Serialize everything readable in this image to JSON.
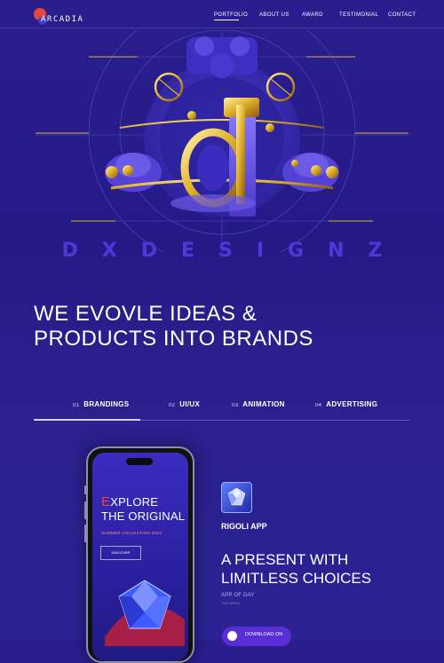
{
  "header": {
    "logo_text": "ARCADIA",
    "nav": [
      {
        "label": "PORTFOLIO"
      },
      {
        "label": "ABOUT US"
      },
      {
        "label": "AWARD"
      },
      {
        "label": "TESTIMONIAL"
      },
      {
        "label": "CONTACT"
      }
    ],
    "active_nav": "PORTFOLIO"
  },
  "hero": {
    "brand_word": "DXDESIGNZ",
    "headline_line1": "WE EVOVLE IDEAS &",
    "headline_line2": "PRODUCTS INTO BRANDS"
  },
  "tabs": [
    {
      "num": "01",
      "label": "BRANDINGS"
    },
    {
      "num": "02",
      "label": "UI/UX"
    },
    {
      "num": "03",
      "label": "ANIMATION"
    },
    {
      "num": "04",
      "label": "ADVERTISING"
    }
  ],
  "active_tab": "BRANDINGS",
  "phone": {
    "title_first_letter": "E",
    "title_rest_line1": "XPLORE",
    "title_line2": "THE ORIGINAL",
    "subtitle": "SUMMER COLLECTION 2023",
    "button_label": "DISCOVER"
  },
  "showcase": {
    "app_name": "RIGOLI APP",
    "tagline_line1": "A PRESENT WITH",
    "tagline_line2": "LIMITLESS CHOICES",
    "app_of_day": "APP OF DAY",
    "the_apple": "THE APPLE",
    "download_label": "DOWNLOAD ON"
  },
  "colors": {
    "background": "#2a1e8e",
    "accent_red": "#e8463a",
    "accent_purple": "#4b3ad8",
    "gold": "#e0b22c",
    "button": "#5a2ed6"
  }
}
